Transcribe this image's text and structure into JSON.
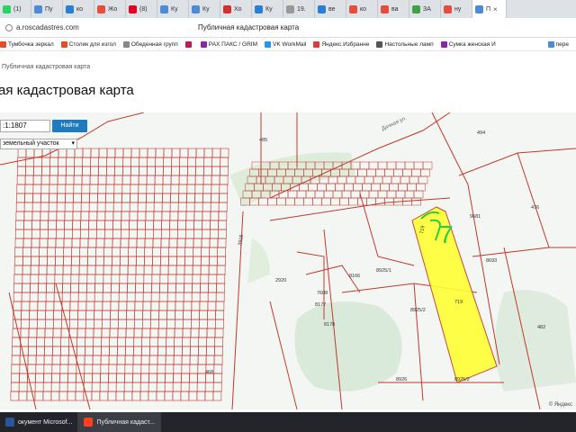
{
  "browser": {
    "tabs": [
      {
        "label": "(1)",
        "color": "#25d366"
      },
      {
        "label": "Пу",
        "color": "#4a8cd6"
      },
      {
        "label": "ко",
        "color": "#2b7fd3"
      },
      {
        "label": "Жо",
        "color": "#e74c3c"
      },
      {
        "label": "(8)",
        "color": "#e60023"
      },
      {
        "label": "Ку",
        "color": "#4a8cd6"
      },
      {
        "label": "Ку",
        "color": "#4a8cd6"
      },
      {
        "label": "Хо",
        "color": "#d32f2f"
      },
      {
        "label": "Ку",
        "color": "#2b7fd3"
      },
      {
        "label": "19.",
        "color": "#999999"
      },
      {
        "label": "ве",
        "color": "#2b7fd3"
      },
      {
        "label": "ко",
        "color": "#e74c3c"
      },
      {
        "label": "ва",
        "color": "#e74c3c"
      },
      {
        "label": "ЗА",
        "color": "#43a047"
      },
      {
        "label": "ну",
        "color": "#e74c3c"
      },
      {
        "label": "П",
        "color": "#4a8cd6",
        "active": true
      }
    ],
    "window_title": "Публичная кадастровая карта",
    "url": "a.roscadastres.com",
    "bookmarks": [
      {
        "label": "Тумбочка зеркал",
        "color": "#e44d26"
      },
      {
        "label": "Столик для изгол",
        "color": "#e44d26"
      },
      {
        "label": "Обеденная групп",
        "color": "#888888"
      },
      {
        "label": "",
        "color": "#c2185b"
      },
      {
        "label": "РАХ ПАКС / GRIM",
        "color": "#8e24aa"
      },
      {
        "label": "VK WorkMail",
        "color": "#2196f3"
      },
      {
        "label": "Яндекс.Избранне",
        "color": "#e53935"
      },
      {
        "label": "Настольные ламп",
        "color": "#555555"
      },
      {
        "label": "Сумка женская И",
        "color": "#8e24aa"
      },
      {
        "label": "пере",
        "color": "#4a8cd6"
      }
    ]
  },
  "page": {
    "breadcrumb": "Публичная кадастровая карта",
    "title": "ая кадастровая карта",
    "search": {
      "value": ":1:1807",
      "button": "Найти"
    },
    "type_select": "земельный участок",
    "map_copyright": "© Яндекс"
  },
  "map_labels": {
    "p485": "485",
    "p494": "494",
    "p9681": "9681",
    "p476": "476",
    "p8693": "8693",
    "p8925_1": "8925/1",
    "p8925_2a": "8925/2",
    "p8925_2b": "8925/2",
    "p719a": "719",
    "p719b": "719",
    "p8166": "8166",
    "p7608": "7608",
    "p8177": "8177",
    "p8178": "8178",
    "p8926": "8926",
    "p482": "482",
    "p468": "468",
    "p2920": "2920",
    "p3915": "3915",
    "hand": "7",
    "street": "Дачная ул."
  },
  "taskbar": [
    {
      "label": "окумент Microsof...",
      "color": "#2b579a"
    },
    {
      "label": "Публичная кадаст...",
      "color": "#fc3f1d",
      "active": true
    }
  ]
}
